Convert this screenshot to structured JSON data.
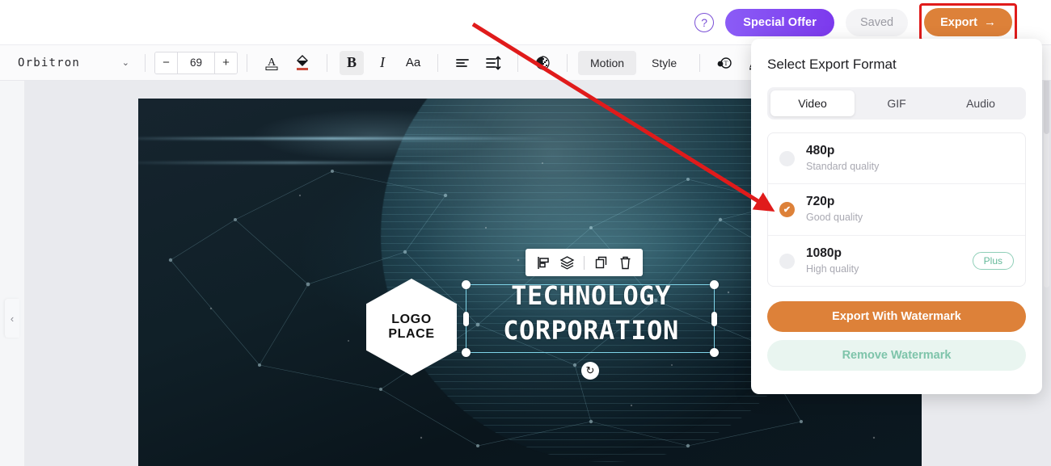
{
  "topbar": {
    "help_icon": "question-circle-icon",
    "special_offer_label": "Special Offer",
    "saved_label": "Saved",
    "export_label": "Export",
    "export_arrow": "→",
    "highlight_color": "#e01b1b",
    "accent_color": "#dd8139",
    "purple_color": "#7c3aed"
  },
  "toolbar": {
    "font_family": "Orbitron",
    "chevron": "⌄",
    "minus": "−",
    "font_size": "69",
    "plus": "+",
    "font_color_icon": "A",
    "fill_color_icon": "fill-bucket-icon",
    "bold": "B",
    "italic": "I",
    "case": "Aa",
    "align_icon": "align-left-icon",
    "line_spacing_icon": "line-spacing-icon",
    "opacity_icon": "opacity-icon",
    "motion_label": "Motion",
    "style_label": "Style",
    "text_effect_icon": "text-effect-icon",
    "pen_icon": "pen-icon"
  },
  "workspace": {
    "collapse_chevron": "‹"
  },
  "canvas": {
    "logo": {
      "line1": "LOGO",
      "line2": "PLACE"
    },
    "title_line1": "TECHNOLOGY",
    "title_line2": "CORPORATION",
    "rotate_icon": "↻",
    "float_toolbar": [
      {
        "name": "align-icon"
      },
      {
        "name": "layers-icon"
      },
      {
        "name": "duplicate-icon"
      },
      {
        "name": "delete-icon"
      }
    ]
  },
  "export_panel": {
    "title": "Select Export Format",
    "tabs": [
      {
        "label": "Video",
        "active": true
      },
      {
        "label": "GIF",
        "active": false
      },
      {
        "label": "Audio",
        "active": false
      }
    ],
    "qualities": [
      {
        "name": "480p",
        "desc": "Standard quality",
        "selected": false,
        "badge": ""
      },
      {
        "name": "720p",
        "desc": "Good quality",
        "selected": true,
        "badge": ""
      },
      {
        "name": "1080p",
        "desc": "High quality",
        "selected": false,
        "badge": "Plus"
      }
    ],
    "check_glyph": "✔",
    "primary_button": "Export With Watermark",
    "ghost_button": "Remove Watermark"
  }
}
